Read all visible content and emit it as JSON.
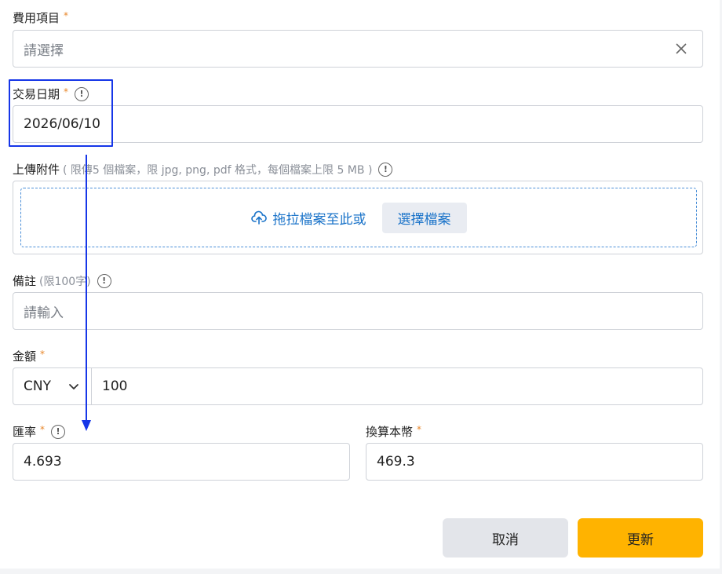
{
  "form": {
    "expense_item": {
      "label": "費用項目",
      "required": "*",
      "placeholder": "請選擇"
    },
    "transaction_date": {
      "label": "交易日期",
      "required": "*",
      "value": "2026/06/10"
    },
    "attachment": {
      "label": "上傳附件",
      "hint": "( 限傳5 個檔案，限 jpg, png, pdf 格式，每個檔案上限 5 MB )",
      "drop_text": "拖拉檔案至此或",
      "choose_label": "選擇檔案"
    },
    "note": {
      "label": "備註",
      "hint": "(限100字)",
      "placeholder": "請輸入"
    },
    "amount": {
      "label": "金額",
      "required": "*",
      "currency": "CNY",
      "value": "100"
    },
    "exchange_rate": {
      "label": "匯率",
      "required": "*",
      "value": "4.693"
    },
    "converted": {
      "label": "換算本幣",
      "required": "*",
      "value": "469.3"
    }
  },
  "actions": {
    "cancel_label": "取消",
    "update_label": "更新"
  },
  "info_glyph": "!",
  "colors": {
    "primary_button": "#ffb300",
    "link": "#1a73c9",
    "required": "#e8872a",
    "annotation": "#1636e8"
  }
}
